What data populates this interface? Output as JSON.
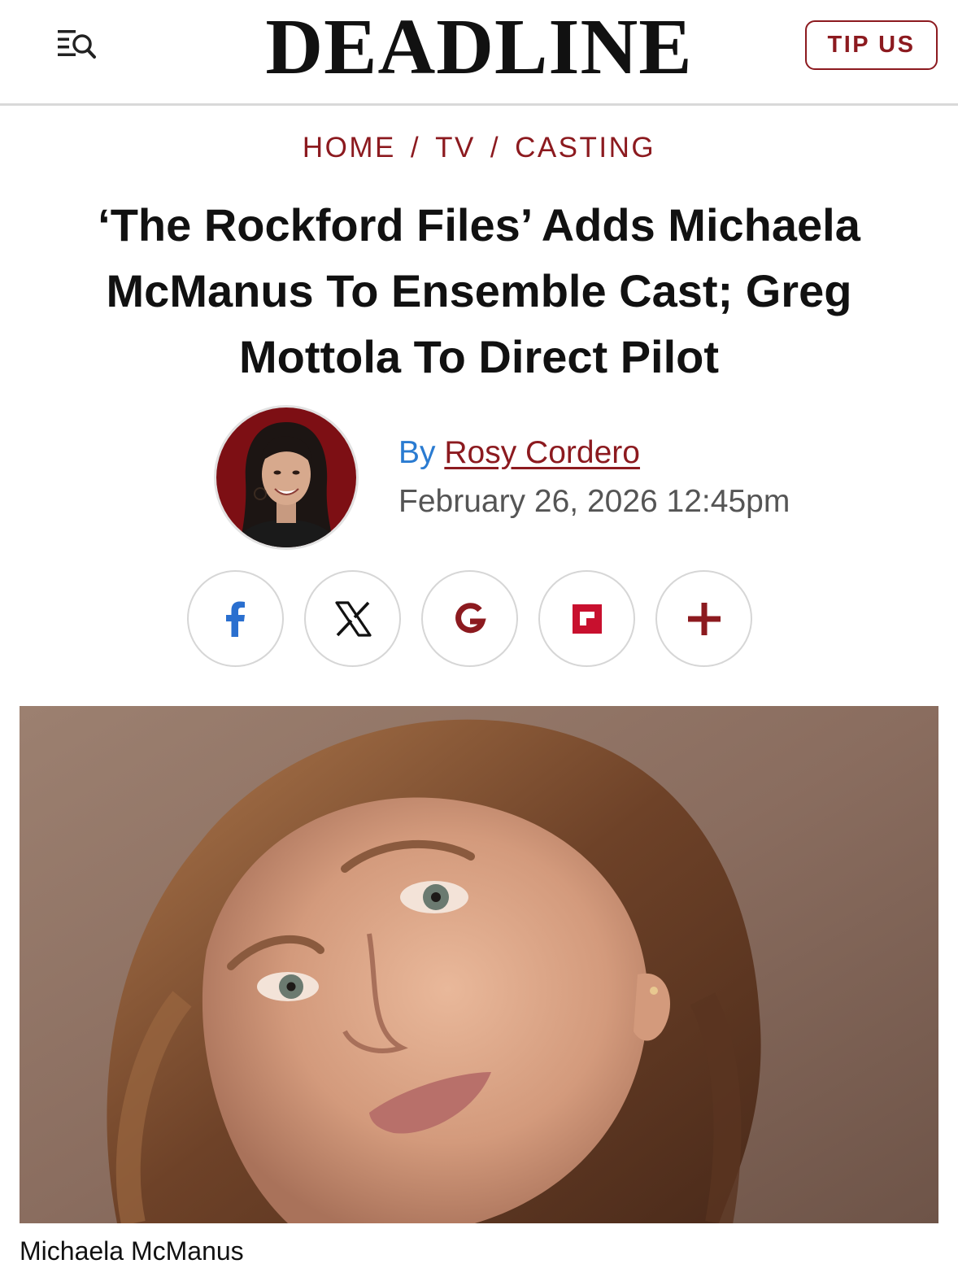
{
  "header": {
    "logo": "DEADLINE",
    "tip_label": "TIP US",
    "menu_icon": "menu-search-icon"
  },
  "breadcrumb": {
    "items": [
      "HOME",
      "TV",
      "CASTING"
    ],
    "separator": "/"
  },
  "article": {
    "title": "‘The Rockford Files’ Adds Michaela McManus To Ensemble Cast; Greg Mottola To Direct Pilot",
    "by_prefix": "By",
    "author": "Rosy Cordero",
    "date": "February 26, 2026 12:45pm",
    "hero_caption": "Michaela McManus"
  },
  "share": [
    {
      "name": "facebook",
      "icon": "facebook-icon",
      "color": "#2a6fcf"
    },
    {
      "name": "x",
      "icon": "x-icon",
      "color": "#111111"
    },
    {
      "name": "google",
      "icon": "google-icon",
      "color": "#8c1a1f"
    },
    {
      "name": "flipboard",
      "icon": "flipboard-icon",
      "color": "#c8102e"
    },
    {
      "name": "more",
      "icon": "plus-icon",
      "color": "#8c1a1f"
    }
  ],
  "colors": {
    "brand_red": "#8c1a1f",
    "link_blue": "#2a7bd1",
    "text_dark": "#111111",
    "text_gray": "#555555"
  }
}
